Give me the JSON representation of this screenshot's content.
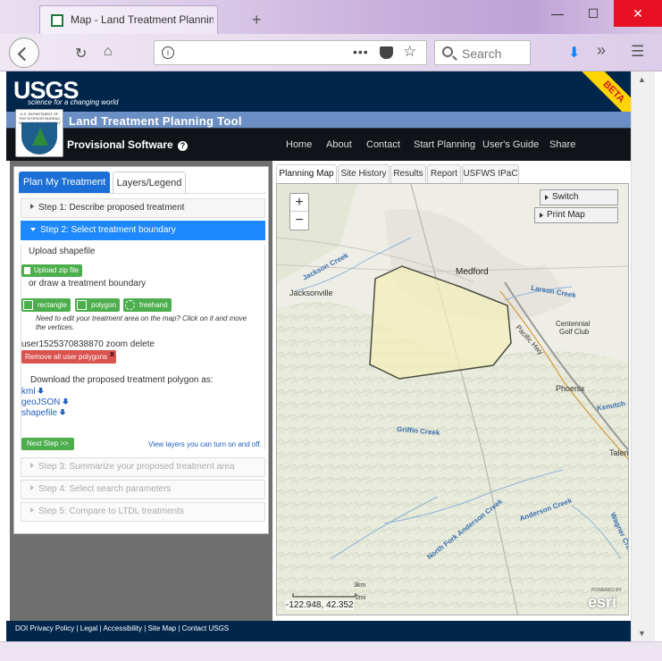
{
  "browser": {
    "tab_title": "Map - Land Treatment Planning",
    "search_placeholder": "Search",
    "url": ""
  },
  "header": {
    "usgs_logo_text": "USGS",
    "usgs_tagline": "science for a changing world",
    "beta_label": "BETA",
    "tool_title": "Land Treatment Planning Tool",
    "badge_caption": "U.S. DEPARTMENT OF THE INTERIOR BUREAU OF LAND MANAGEMENT",
    "provisional_label": "Provisional Software",
    "help_icon_text": "?",
    "nav": [
      "Home",
      "About",
      "Contact",
      "Start Planning",
      "User's Guide",
      "Share"
    ]
  },
  "panel": {
    "tabs": [
      "Plan My Treatment",
      "Layers/Legend"
    ],
    "steps": [
      "Step 1: Describe proposed treatment",
      "Step 2: Select treatment boundary",
      "Step 3: Summarize your proposed treatment area",
      "Step 4: Select search parameters",
      "Step 5: Compare to LTDL treatments"
    ],
    "upload_label": "Upload shapefile",
    "upload_button": "Upload zip file",
    "draw_label": "or draw a treatment boundary",
    "shape_buttons": [
      "rectangle",
      "polygon",
      "freehand"
    ],
    "edit_note": "Need to edit your treatment area on the map? Click on it and move the vertices.",
    "polygon_name": "user1525370838870",
    "polygon_zoom": "zoom",
    "polygon_delete": "delete",
    "remove_all_button": "Remove all user polygons",
    "remove_x": "x",
    "download_label": "Download the proposed treatment polygon as:",
    "download_links": [
      "kml",
      "geoJSON",
      "shapefile"
    ],
    "next_button": "Next Step >>",
    "view_layers_link": "View layers you can turn on and off."
  },
  "map": {
    "tabs": [
      "Planning Map",
      "Site History",
      "Results",
      "Report",
      "USFWS IPaC"
    ],
    "switch_basemap": "Switch Basemap",
    "print_map": "Print Map",
    "zoom_in": "+",
    "zoom_out": "−",
    "labels": {
      "medford": "Medford",
      "jacksonville": "Jacksonville",
      "phoenix": "Phoenix",
      "talent": "Talent",
      "centennial": "Centennial",
      "golf_club": "Golf Club",
      "jackson_creek": "Jackson Creek",
      "larson_creek": "Larson Creek",
      "griffin_creek": "Griffin Creek",
      "anderson_creek": "Anderson Creek",
      "north_fork_anderson": "North Fork Anderson Creek",
      "wagner_creek": "Wagner Creek",
      "kenutchin": "Kenutch",
      "pacific_hwy": "Pacific Hwy"
    },
    "scale_km": "3km",
    "scale_mi": "2mi",
    "coordinates": "-122.948, 42.352",
    "esri_powered": "POWERED BY",
    "esri_logo": "esri"
  },
  "footer": {
    "links": [
      "DOI Privacy Policy",
      "Legal",
      "Accessibility",
      "Site Map",
      "Contact USGS"
    ]
  }
}
